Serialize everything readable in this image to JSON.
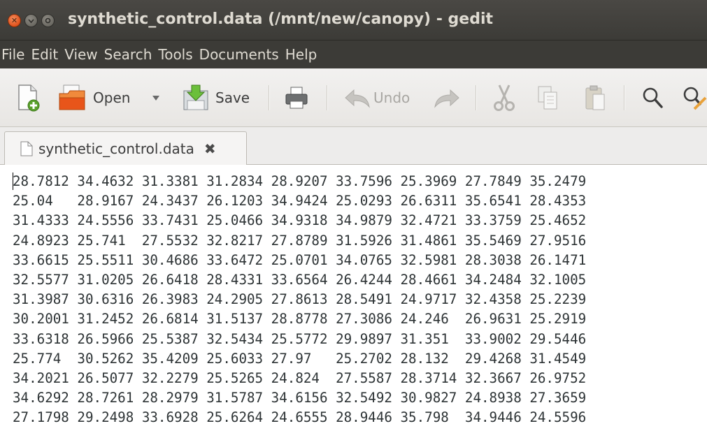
{
  "window": {
    "title": "synthetic_control.data (/mnt/new/canopy) - gedit",
    "controls": [
      "close-icon",
      "minimize-icon",
      "maximize-icon"
    ]
  },
  "menubar": {
    "items": [
      "File",
      "Edit",
      "View",
      "Search",
      "Tools",
      "Documents",
      "Help"
    ]
  },
  "toolbar": {
    "open_label": "Open",
    "save_label": "Save",
    "undo_label": "Undo"
  },
  "tab": {
    "label": "synthetic_control.data",
    "close_glyph": "✖"
  },
  "editor": {
    "lines": [
      "28.7812 34.4632 31.3381 31.2834 28.9207 33.7596 25.3969 27.7849 35.2479",
      "25.04   28.9167 24.3437 26.1203 34.9424 25.0293 26.6311 35.6541 28.4353",
      "31.4333 24.5556 33.7431 25.0466 34.9318 34.9879 32.4721 33.3759 25.4652",
      "24.8923 25.741  27.5532 32.8217 27.8789 31.5926 31.4861 35.5469 27.9516",
      "33.6615 25.5511 30.4686 33.6472 25.0701 34.0765 32.5981 28.3038 26.1471",
      "32.5577 31.0205 26.6418 28.4331 33.6564 26.4244 28.4661 34.2484 32.1005",
      "31.3987 30.6316 26.3983 24.2905 27.8613 28.5491 24.9717 32.4358 25.2239",
      "30.2001 31.2452 26.6814 31.5137 28.8778 27.3086 24.246  26.9631 25.2919",
      "33.6318 26.5966 25.5387 32.5434 25.5772 29.9897 31.351  33.9002 29.5446",
      "25.774  30.5262 35.4209 25.6033 27.97   25.2702 28.132  29.4268 31.4549",
      "34.2021 26.5077 32.2279 25.5265 24.824  27.5587 28.3714 32.3667 26.9752",
      "34.6292 28.7261 28.2979 31.5787 34.6156 32.5492 30.9827 24.8938 27.3659",
      "27.1798 29.2498 33.6928 25.6264 24.6555 28.9446 35.798  34.9446 24.5596"
    ]
  }
}
